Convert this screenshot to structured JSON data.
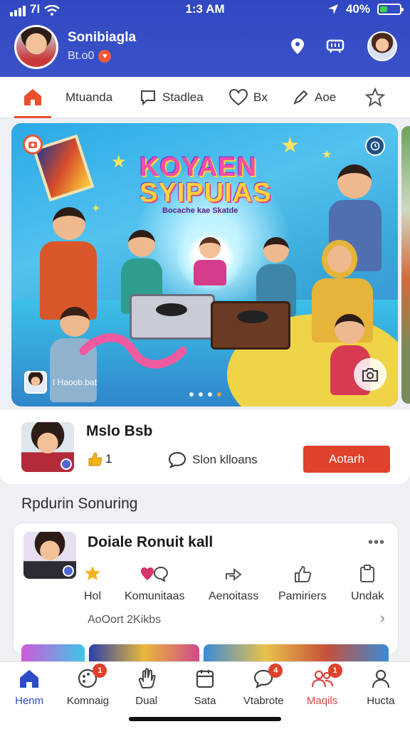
{
  "status_bar": {
    "network": "7I",
    "time": "1:3 AM",
    "battery_text": "40%",
    "battery_level": 0.4
  },
  "header": {
    "user_name": "Sonibiagla",
    "user_sub": "Bt.o0"
  },
  "tabs": [
    {
      "label": "Mtuanda",
      "icon": "chat-bubble-icon"
    },
    {
      "label": "Stadlea",
      "icon": "chat-bubble-icon"
    },
    {
      "label": "Bx",
      "icon": "heart-icon"
    },
    {
      "label": "Aoe",
      "icon": "share-icon"
    }
  ],
  "hero": {
    "title_line1": "KOYAEN",
    "title_line2": "SYIPUIAS",
    "subtitle": "Bocache kae Skatde",
    "credit": "I Haoob.bat",
    "dots_count": 4,
    "active_dot": 3
  },
  "post": {
    "name": "Mslo Bsb",
    "likes": "1",
    "comment_label": "Slon klloans",
    "action_label": "Aotarh"
  },
  "section_title": "Rpdurin Sonuring",
  "community": {
    "title": "Doiale Ronuit kall",
    "more": "•••",
    "actions": [
      {
        "label": "Hol",
        "icon": "star-hand-icon",
        "color": "#f2b31c"
      },
      {
        "label": "Komunitaas",
        "icon": "heart-chat-icon",
        "color": "#d6336c"
      },
      {
        "label": "Aenoitass",
        "icon": "share-arrow-icon",
        "color": "#555555"
      },
      {
        "label": "Pamiriers",
        "icon": "thumb-icon",
        "color": "#555555"
      },
      {
        "label": "Undak",
        "icon": "clipboard-icon",
        "color": "#555555"
      }
    ],
    "sub_text": "AoOort 2Kikbs",
    "chevron": "›"
  },
  "bottom_nav": [
    {
      "label": "Henm",
      "icon": "home-icon",
      "badge": "",
      "active": true
    },
    {
      "label": "Komnaig",
      "icon": "palette-icon",
      "badge": "1",
      "active": false
    },
    {
      "label": "Dual",
      "icon": "hand-icon",
      "badge": "",
      "active": false
    },
    {
      "label": "Sata",
      "icon": "calendar-icon",
      "badge": "",
      "active": false
    },
    {
      "label": "Vtabrote",
      "icon": "chat-icon",
      "badge": "4",
      "active": false
    },
    {
      "label": "Maqils",
      "icon": "people-icon",
      "badge": "1",
      "active": false
    },
    {
      "label": "Hucta",
      "icon": "profile-icon",
      "badge": "",
      "active": false
    }
  ],
  "colors": {
    "header_bg": "#3148c2",
    "accent": "#e8502d",
    "button": "#e0412b",
    "nav_active": "#2c4bc5"
  }
}
